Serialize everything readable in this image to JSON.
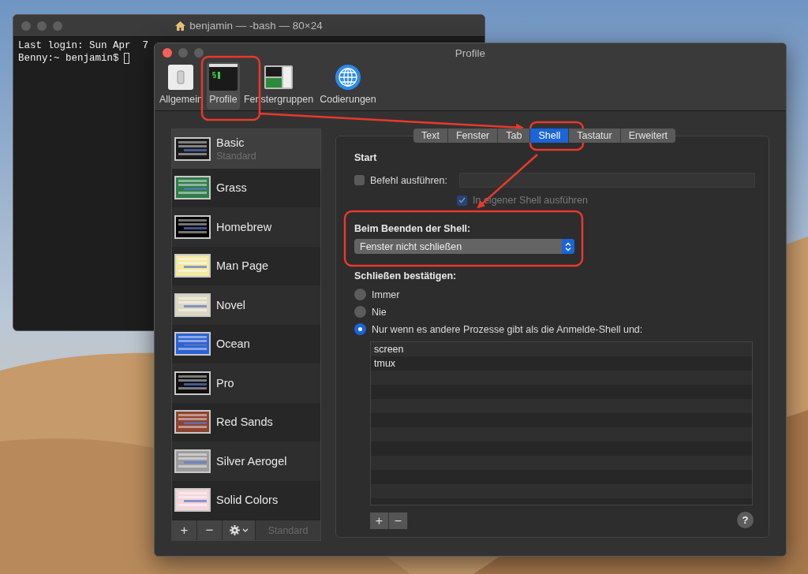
{
  "terminal": {
    "title": "benjamin — -bash — 80×24",
    "lines": [
      "Last login: Sun Apr  7",
      "Benny:~ benjamin$"
    ]
  },
  "window": {
    "title": "Profile"
  },
  "toolbar": [
    {
      "label": "Allgemein",
      "kind": "switch",
      "selected": false
    },
    {
      "label": "Profile",
      "kind": "terminal",
      "selected": true
    },
    {
      "label": "Fenstergruppen",
      "kind": "windows",
      "selected": false
    },
    {
      "label": "Codierungen",
      "kind": "globe",
      "selected": false
    }
  ],
  "profiles": [
    {
      "name": "Basic",
      "subtitle": "Standard",
      "selected": true,
      "color": "#1a1a1a"
    },
    {
      "name": "Grass",
      "selected": false,
      "color": "#2f7d4a"
    },
    {
      "name": "Homebrew",
      "selected": false,
      "color": "#000000"
    },
    {
      "name": "Man Page",
      "selected": false,
      "color": "#f3e9a2"
    },
    {
      "name": "Novel",
      "selected": false,
      "color": "#dcd7c0"
    },
    {
      "name": "Ocean",
      "selected": false,
      "color": "#2c62d2"
    },
    {
      "name": "Pro",
      "selected": false,
      "color": "#101010"
    },
    {
      "name": "Red Sands",
      "selected": false,
      "color": "#8e4331"
    },
    {
      "name": "Silver Aerogel",
      "selected": false,
      "color": "#9d9d9d"
    },
    {
      "name": "Solid Colors",
      "selected": false,
      "color": "#f3d5dc"
    }
  ],
  "profile_buttons": [
    "+",
    "−"
  ],
  "default_button": {
    "label": "Standard",
    "disabled": true
  },
  "tabs": [
    {
      "label": "Text",
      "selected": false
    },
    {
      "label": "Fenster",
      "selected": false
    },
    {
      "label": "Tab",
      "selected": false
    },
    {
      "label": "Shell",
      "selected": true
    },
    {
      "label": "Tastatur",
      "selected": false
    },
    {
      "label": "Erweitert",
      "selected": false
    }
  ],
  "start": {
    "heading": "Start",
    "run_command": {
      "label": "Befehl ausführen:",
      "checked": false
    },
    "own_shell": {
      "label": "In eigener Shell ausführen",
      "checked": true,
      "disabled": true
    }
  },
  "on_exit": {
    "heading": "Beim Beenden der Shell:",
    "value": "Fenster nicht schließen"
  },
  "confirm": {
    "heading": "Schließen bestätigen:",
    "options": [
      {
        "label": "Immer",
        "selected": false
      },
      {
        "label": "Nie",
        "selected": false
      },
      {
        "label": "Nur wenn es andere Prozesse gibt als die Anmelde-Shell und:",
        "selected": true
      }
    ]
  },
  "processes": [
    "screen",
    "tmux"
  ],
  "process_buttons": [
    "+",
    "−"
  ],
  "help": "?"
}
